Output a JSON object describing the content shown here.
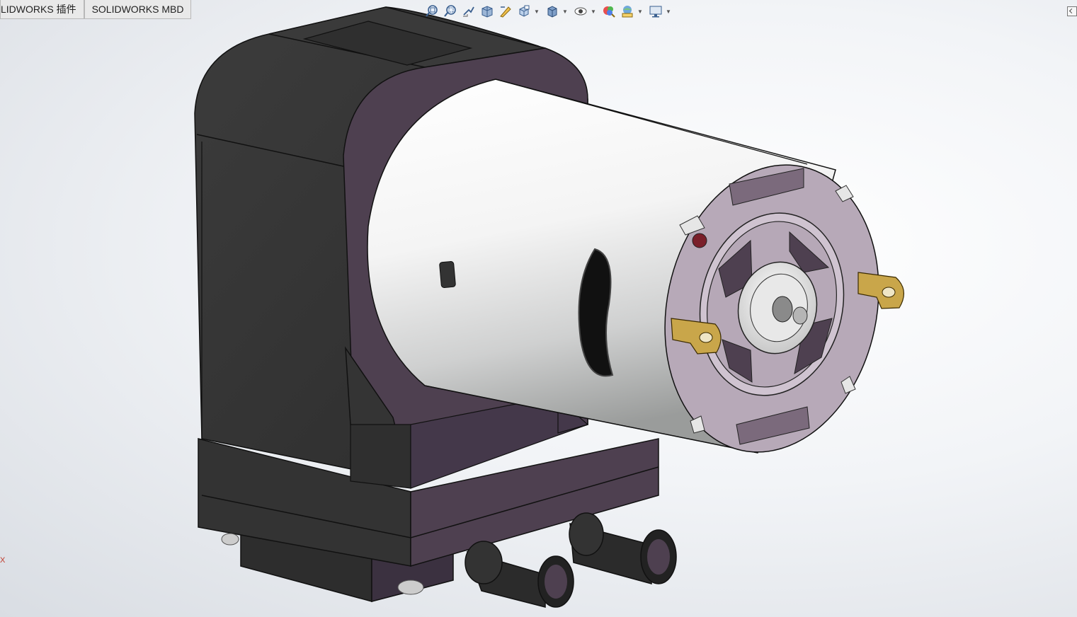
{
  "tabs": [
    {
      "label": "LIDWORKS 插件"
    },
    {
      "label": "SOLIDWORKS MBD"
    }
  ],
  "heads_up_toolbar": [
    {
      "icon": "zoom-to-fit-icon",
      "caret": false
    },
    {
      "icon": "zoom-to-area-icon",
      "caret": false
    },
    {
      "icon": "previous-view-icon",
      "caret": false
    },
    {
      "icon": "section-view-icon",
      "caret": false
    },
    {
      "icon": "dynamic-annotation-icon",
      "caret": false
    },
    {
      "icon": "view-orientation-icon",
      "caret": true
    },
    {
      "icon": "display-style-icon",
      "caret": true
    },
    {
      "icon": "hide-show-items-icon",
      "caret": true
    },
    {
      "icon": "edit-appearance-icon",
      "caret": false
    },
    {
      "icon": "apply-scene-icon",
      "caret": true
    },
    {
      "icon": "view-settings-icon",
      "caret": true
    }
  ],
  "triad": {
    "axis_label": "X"
  },
  "colors": {
    "housing_dark": "#3a3a3a",
    "housing_purple": "#4e4050",
    "motor_can": "#f4f4f4",
    "endcap": "#b7a9b8",
    "terminal": "#c9a64a"
  }
}
